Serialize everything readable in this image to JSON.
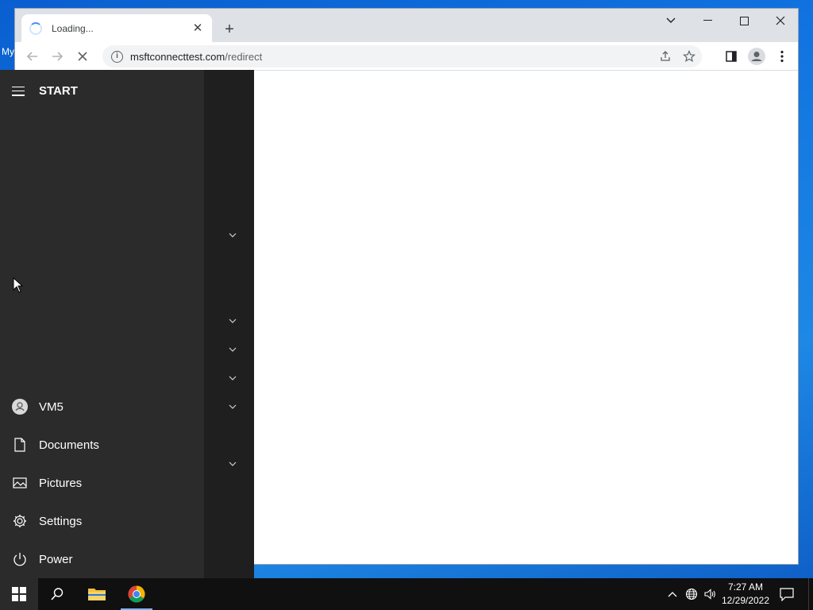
{
  "desktop": {
    "partial_icon_text": "My"
  },
  "browser": {
    "tab": {
      "title": "Loading..."
    },
    "window_controls": [
      "tab-search",
      "minimize",
      "maximize",
      "close"
    ],
    "toolbar": {
      "url_host": "msftconnecttest.com",
      "url_path": "/redirect"
    }
  },
  "start_menu": {
    "title": "START",
    "items": [
      {
        "label": "VM5",
        "icon": "user-icon"
      },
      {
        "label": "Documents",
        "icon": "document-icon"
      },
      {
        "label": "Pictures",
        "icon": "pictures-icon"
      },
      {
        "label": "Settings",
        "icon": "gear-icon"
      },
      {
        "label": "Power",
        "icon": "power-icon"
      }
    ]
  },
  "taskbar": {
    "clock_time": "7:27 AM",
    "clock_date": "12/29/2022"
  },
  "colors": {
    "accent": "#0a5fcf",
    "taskbar": "#101010",
    "start_left": "#2b2b2b",
    "start_right": "#1f1f1f"
  }
}
